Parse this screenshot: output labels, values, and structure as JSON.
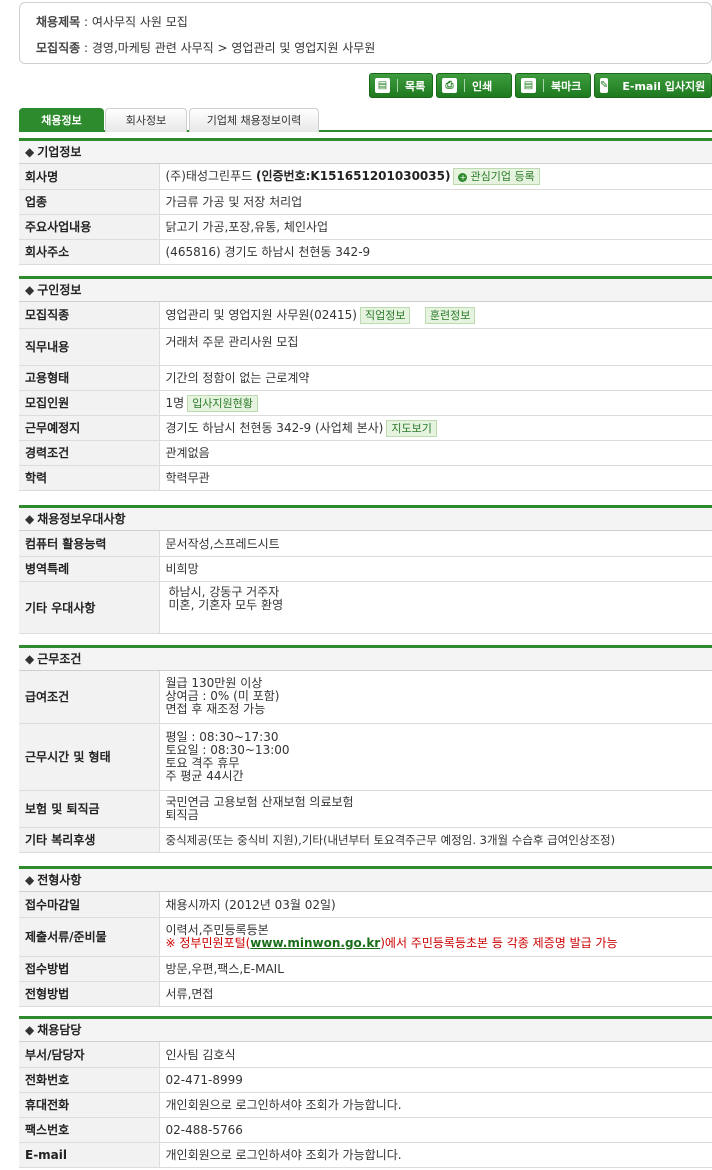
{
  "summary": {
    "title_label": "채용제목",
    "title_value": "여사무직 사원 모집",
    "job_label": "모집직종",
    "job_value": "경영,마케팅 관련 사무직 > 영업관리 및 영업지원 사무원"
  },
  "buttons": [
    {
      "icon": "list-icon",
      "glyph": "▤",
      "label": "목록"
    },
    {
      "icon": "print-icon",
      "glyph": "⎙",
      "label": "인쇄"
    },
    {
      "icon": "bookmark-icon",
      "glyph": "▤",
      "label": "북마크"
    },
    {
      "icon": "pen-icon",
      "glyph": "✎",
      "label": "E-mail 입사지원"
    }
  ],
  "tabs": [
    "채용정보",
    "회사정보",
    "기업체 채용정보이력"
  ],
  "company": {
    "heading": "기업정보",
    "name_label": "회사명",
    "name_value": "(주)태성그린푸드",
    "cert": "(인증번호:K151651201030035)",
    "interest_badge": "관심기업 등록",
    "industry_label": "업종",
    "industry_value": "가금류 가공 및 저장 처리업",
    "business_label": "주요사업내용",
    "business_value": "닭고기 가공,포장,유통, 체인사업",
    "address_label": "회사주소",
    "address_value": "(465816) 경기도 하남시 천현동 342-9"
  },
  "recruit": {
    "heading": "구인정보",
    "job_label": "모집직종",
    "job_value": "영업관리 및 영업지원 사무원(02415)",
    "job_badge1": "직업정보",
    "job_badge2": "훈련정보",
    "duty_label": "직무내용",
    "duty_value": "거래처 주문 관리사원 모집",
    "employ_label": "고용형태",
    "employ_value": "기간의 정함이 없는 근로계약",
    "count_label": "모집인원",
    "count_value": "1명",
    "count_badge": "입사지원현황",
    "place_label": "근무예정지",
    "place_value": "경기도 하남시 천현동 342-9 (사업체 본사)",
    "place_badge": "지도보기",
    "career_label": "경력조건",
    "career_value": "관계없음",
    "edu_label": "학력",
    "edu_value": "학력무관"
  },
  "prefer": {
    "heading": "채용정보우대사항",
    "pc_label": "컴퓨터 활용능력",
    "pc_value": "문서작성,스프레드시트",
    "mil_label": "병역특례",
    "mil_value": "비희망",
    "etc_label": "기타 우대사항",
    "etc_lines": [
      "하남시, 강동구 거주자",
      "미혼, 기혼자 모두 환영"
    ]
  },
  "conditions": {
    "heading": "근무조건",
    "pay_label": "급여조건",
    "pay_lines": [
      "월급 130만원 이상",
      "상여금 : 0% (미 포함)",
      "면접 후 재조정 가능"
    ],
    "hours_label": "근무시간 및 형태",
    "hours_lines": [
      "평일 : 08:30~17:30",
      "토요일 : 08:30~13:00",
      "토요 격주 휴무",
      "주 평균 44시간"
    ],
    "ins_label": "보험 및 퇴직금",
    "ins_lines": [
      "국민연금 고용보험 산재보험 의료보험",
      "퇴직금"
    ],
    "welfare_label": "기타 복리후생",
    "welfare_value": "중식제공(또는 중식비 지원),기타(내년부터 토요격주근무 예정임. 3개월 수습후 급여인상조정)"
  },
  "selection": {
    "heading": "전형사항",
    "deadline_label": "접수마감일",
    "deadline_value": "채용시까지 (2012년 03월 02일)",
    "docs_label": "제출서류/준비물",
    "docs_value": "이력서,주민등록등본",
    "docs_note_pre": "※ 정부민원포털(",
    "docs_note_link": "www.minwon.go.kr",
    "docs_note_post": ")에서 주민등록등초본 등 각종 제증명 발급 가능",
    "method_label": "접수방법",
    "method_value": "방문,우편,팩스,E-MAIL",
    "process_label": "전형방법",
    "process_value": "서류,면접"
  },
  "contact": {
    "heading": "채용담당",
    "dept_label": "부서/담당자",
    "dept_value": "인사팀 김호식",
    "phone_label": "전화번호",
    "phone_value": "02-471-8999",
    "mobile_label": "휴대전화",
    "mobile_value": "개인회원으로 로그인하셔야 조회가 가능합니다.",
    "fax_label": "팩스번호",
    "fax_value": "02-488-5766",
    "email_label": "E-mail",
    "email_value": "개인회원으로 로그인하셔야 조회가 가능합니다."
  }
}
